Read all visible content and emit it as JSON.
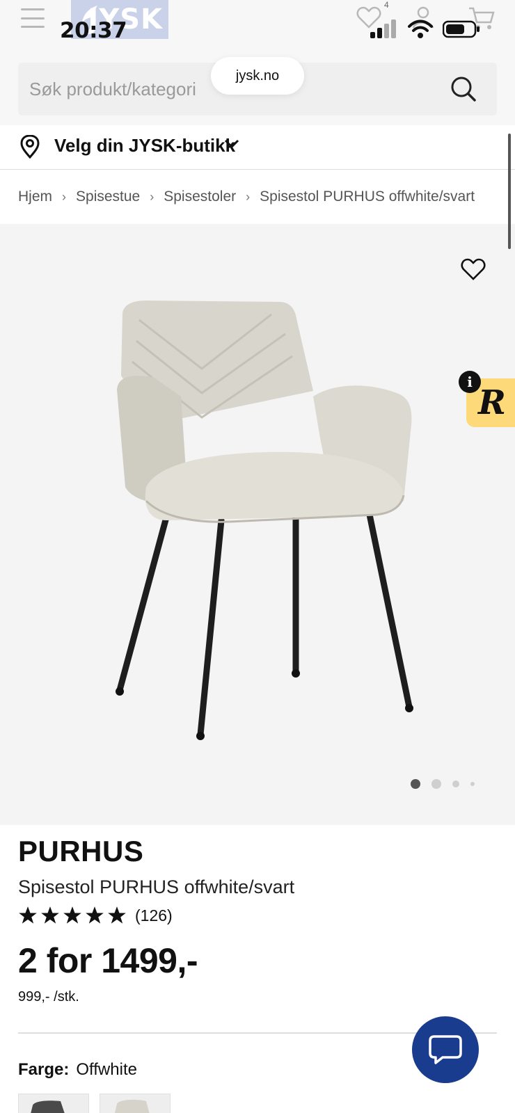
{
  "status_bar": {
    "time": "20:37"
  },
  "header": {
    "logo_text": "JYSK",
    "wishlist_count": "4",
    "url": "jysk.no",
    "icons": [
      "menu-icon",
      "heart-icon",
      "user-icon",
      "cart-icon"
    ]
  },
  "search": {
    "placeholder": "Søk produkt/kategori"
  },
  "store": {
    "label": "Velg din JYSK-butikk"
  },
  "breadcrumb": [
    "Hjem",
    "Spisestue",
    "Spisestoler",
    "Spisestol PURHUS offwhite/svart"
  ],
  "gallery": {
    "image_count": 4,
    "active_index": 0
  },
  "badge": {
    "info": "i",
    "letter": "R"
  },
  "product": {
    "brand": "PURHUS",
    "name": "Spisestol PURHUS offwhite/svart",
    "rating_count": "(126)",
    "stars": 5,
    "price_main": "2 for 1499,-",
    "price_unit": "999,- /stk.",
    "color_label": "Farge:",
    "color_value": "Offwhite"
  },
  "colors": {
    "brand_blue": "#1a3c8f",
    "badge_yellow": "#fdd97a"
  }
}
